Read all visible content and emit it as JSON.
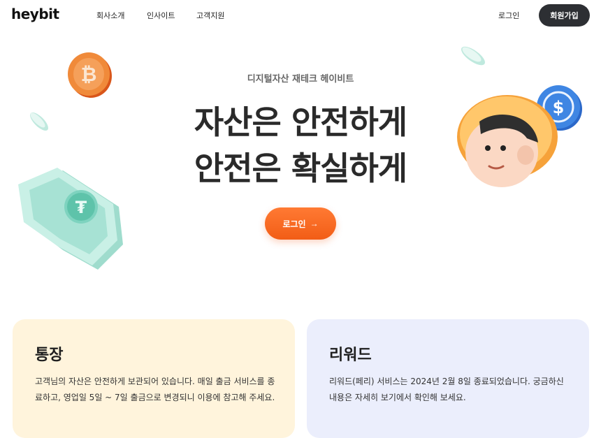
{
  "header": {
    "logo": "heybit",
    "nav": [
      "회사소개",
      "인사이트",
      "고객지원"
    ],
    "login_label": "로그인",
    "signup_label": "회원가입"
  },
  "hero": {
    "subtitle": "디지털자산 재테크 헤이비트",
    "title_line1": "자산은 안전하게",
    "title_line2": "안전은 확실하게",
    "cta_label": "로그인",
    "cta_arrow": "→"
  },
  "cards": [
    {
      "title": "통장",
      "body": "고객님의 자산은 안전하게 보관되어 있습니다. 매일 출금 서비스를 종료하고, 영업일 5일 ~ 7일 출금으로 변경되니 이용에 참고해 주세요."
    },
    {
      "title": "리워드",
      "body": "리워드(페리) 서비스는 2024년 2월 8일 종료되었습니다. 궁금하신 내용은 자세히 보기에서 확인해 보세요."
    }
  ],
  "colors": {
    "accent": "#f25d16",
    "dark": "#2d2f33",
    "card_yellow": "#fff4dc",
    "card_lavender": "#ebeefc"
  },
  "icons": [
    "bitcoin-coin-icon",
    "usdc-coin-icon",
    "tether-shield-icon",
    "avatar-illustration"
  ]
}
